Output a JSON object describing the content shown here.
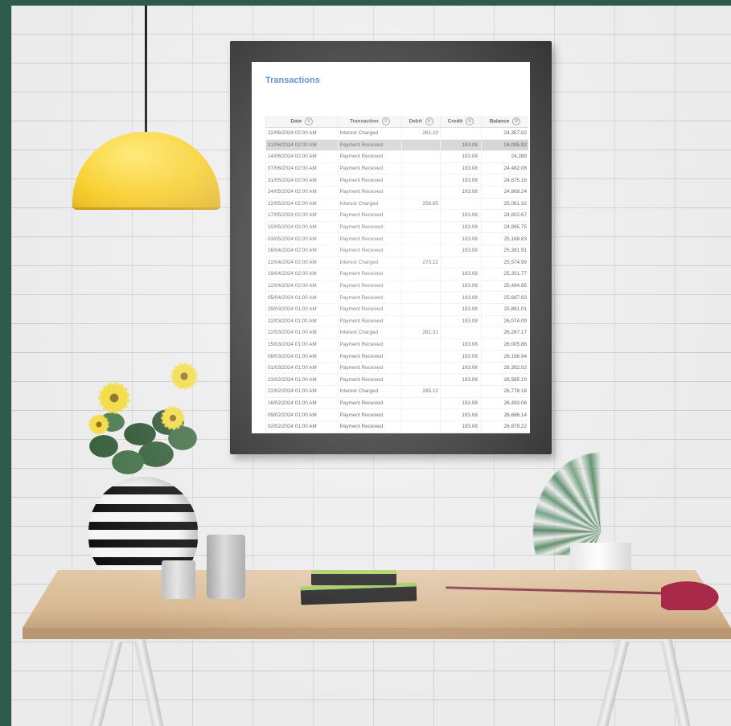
{
  "document": {
    "title": "Transactions",
    "columns": [
      "Date",
      "Transaction",
      "Debit",
      "Credit",
      "Balance"
    ],
    "filter_icon": "filter-icon",
    "rows": [
      [
        "22/06/2024 02:00 AM",
        "Interest Charged",
        "261.10",
        "",
        "24,357.02"
      ],
      [
        "21/06/2024 02:00 AM",
        "Payment Received",
        "",
        "193.08",
        "24,095.92"
      ],
      [
        "14/06/2024 02:00 AM",
        "Payment Received",
        "",
        "193.08",
        "24,289"
      ],
      [
        "07/06/2024 02:00 AM",
        "Payment Received",
        "",
        "193.08",
        "24,482.08"
      ],
      [
        "31/05/2024 02:00 AM",
        "Payment Received",
        "",
        "193.08",
        "24,675.16"
      ],
      [
        "24/05/2024 02:00 AM",
        "Payment Received",
        "",
        "193.08",
        "24,868.24"
      ],
      [
        "22/05/2024 02:00 AM",
        "Interest Charged",
        "258.65",
        "",
        "25,061.32"
      ],
      [
        "17/05/2024 02:00 AM",
        "Payment Received",
        "",
        "193.08",
        "24,802.67"
      ],
      [
        "10/05/2024 02:00 AM",
        "Payment Received",
        "",
        "193.08",
        "24,995.75"
      ],
      [
        "03/05/2024 02:00 AM",
        "Payment Received",
        "",
        "193.08",
        "25,188.83"
      ],
      [
        "26/04/2024 02:00 AM",
        "Payment Received",
        "",
        "193.08",
        "25,381.91"
      ],
      [
        "22/04/2024 02:00 AM",
        "Interest Charged",
        "273.22",
        "",
        "25,574.99"
      ],
      [
        "19/04/2024 02:00 AM",
        "Payment Received",
        "",
        "193.08",
        "25,301.77"
      ],
      [
        "12/04/2024 02:00 AM",
        "Payment Received",
        "",
        "193.08",
        "25,494.85"
      ],
      [
        "05/04/2024 01:00 AM",
        "Payment Received",
        "",
        "193.08",
        "25,687.93"
      ],
      [
        "29/03/2024 01:00 AM",
        "Payment Received",
        "",
        "193.08",
        "25,881.01"
      ],
      [
        "22/03/2024 01:00 AM",
        "Payment Received",
        "",
        "193.08",
        "26,074.09"
      ],
      [
        "22/03/2024 01:00 AM",
        "Interest Charged",
        "261.31",
        "",
        "26,267.17"
      ],
      [
        "15/03/2024 01:00 AM",
        "Payment Received",
        "",
        "193.08",
        "26,005.86"
      ],
      [
        "08/03/2024 01:00 AM",
        "Payment Received",
        "",
        "193.08",
        "26,198.94"
      ],
      [
        "01/03/2024 01:00 AM",
        "Payment Received",
        "",
        "193.08",
        "26,392.02"
      ],
      [
        "23/02/2024 01:00 AM",
        "Payment Received",
        "",
        "193.08",
        "26,585.10"
      ],
      [
        "22/02/2024 01:00 AM",
        "Interest Charged",
        "285.12",
        "",
        "26,778.18"
      ],
      [
        "16/02/2024 01:00 AM",
        "Payment Received",
        "",
        "193.08",
        "26,493.06"
      ],
      [
        "09/02/2024 01:00 AM",
        "Payment Received",
        "",
        "193.08",
        "26,686.14"
      ],
      [
        "02/02/2024 01:00 AM",
        "Payment Received",
        "",
        "193.08",
        "26,879.22"
      ]
    ],
    "selected_row": 1
  },
  "colors": {
    "title": "#2f6fc6",
    "frame": "#151515",
    "lamp": "#f7cc1f",
    "page_border": "#2f5b4c"
  }
}
